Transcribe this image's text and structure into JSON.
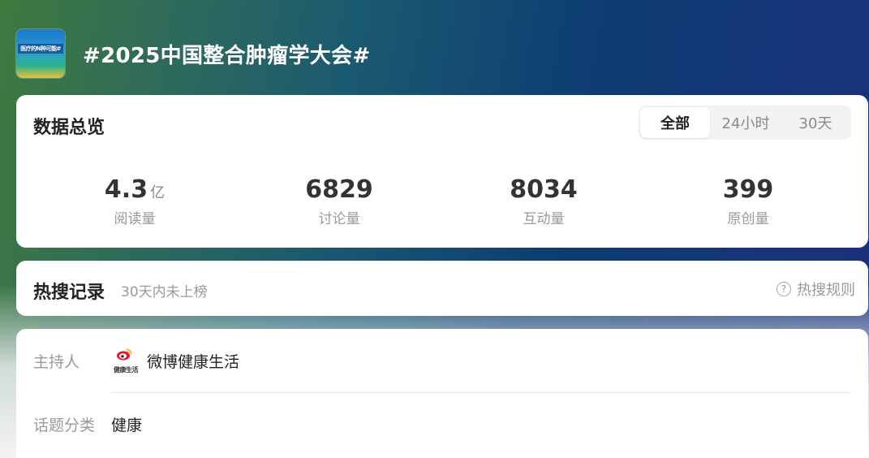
{
  "header": {
    "logo_text": "医疗的N种可能#",
    "title": "#2025中国整合肿瘤学大会#"
  },
  "overview": {
    "title": "数据总览",
    "tabs": [
      {
        "label": "全部",
        "active": true
      },
      {
        "label": "24小时",
        "active": false
      },
      {
        "label": "30天",
        "active": false
      }
    ],
    "stats": [
      {
        "value": "4.3",
        "unit": "亿",
        "label": "阅读量"
      },
      {
        "value": "6829",
        "unit": "",
        "label": "讨论量"
      },
      {
        "value": "8034",
        "unit": "",
        "label": "互动量"
      },
      {
        "value": "399",
        "unit": "",
        "label": "原创量"
      }
    ]
  },
  "hot_search": {
    "title": "热搜记录",
    "subtitle": "30天内未上榜",
    "rules_label": "热搜规则",
    "rules_icon": "question-circle-icon"
  },
  "info": {
    "host_label": "主持人",
    "host_avatar_text": "健康生活",
    "host_name": "微博健康生活",
    "category_label": "话题分类",
    "category_value": "健康"
  },
  "colors": {
    "background_start": "#3e7a3e",
    "background_end": "#1b2f7e",
    "weibo_red": "#e6162d",
    "weibo_orange": "#f5a623"
  }
}
